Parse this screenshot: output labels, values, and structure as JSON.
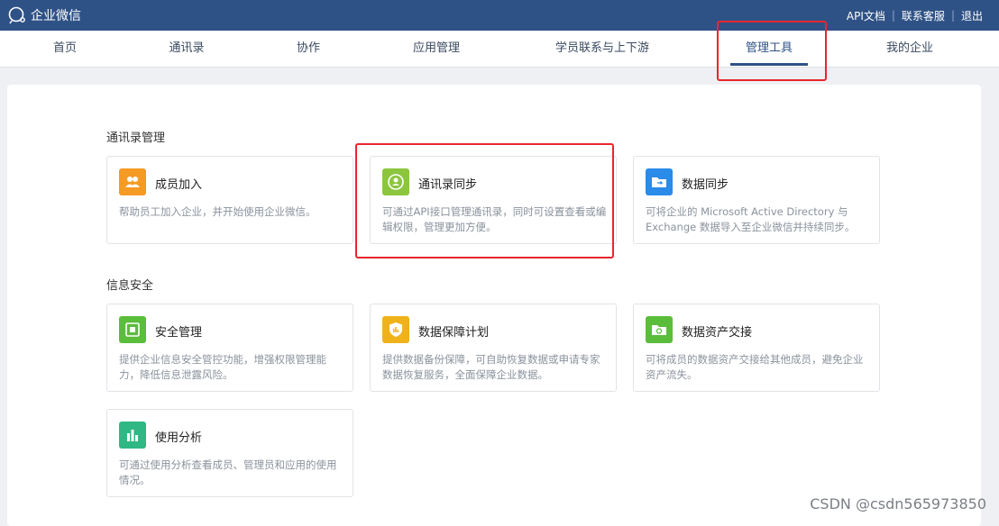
{
  "app": {
    "name": "企业微信"
  },
  "toplinks": [
    "API文档",
    "联系客服",
    "退出"
  ],
  "nav": [
    "首页",
    "通讯录",
    "协作",
    "应用管理",
    "学员联系与上下游",
    "管理工具",
    "我的企业"
  ],
  "sections": {
    "contacts": "通讯录管理",
    "security": "信息安全"
  },
  "cards": [
    {
      "title": "成员加入",
      "desc": "帮助员工加入企业，并开始使用企业微信。",
      "color": "#f59a23"
    },
    {
      "title": "通讯录同步",
      "desc": "可通过API接口管理通讯录，同时可设置查看或编辑权限，管理更加方便。",
      "color": "#8cc63e"
    },
    {
      "title": "数据同步",
      "desc": "可将企业的 Microsoft Active Directory 与 Exchange 数据导入至企业微信并持续同步。",
      "color": "#2a8be8"
    },
    {
      "title": "安全管理",
      "desc": "提供企业信息安全管控功能，增强权限管理能力，降低信息泄露风险。",
      "color": "#5bbd3c"
    },
    {
      "title": "数据保障计划",
      "desc": "提供数据备份保障，可自助恢复数据或申请专家数据恢复服务，全面保障企业数据。",
      "color": "#f0b21a"
    },
    {
      "title": "数据资产交接",
      "desc": "可将成员的数据资产交接给其他成员，避免企业资产流失。",
      "color": "#5bbd3c"
    },
    {
      "title": "使用分析",
      "desc": "可通过使用分析查看成员、管理员和应用的使用情况。",
      "color": "#2fb883"
    }
  ],
  "watermark": "CSDN @csdn565973850"
}
